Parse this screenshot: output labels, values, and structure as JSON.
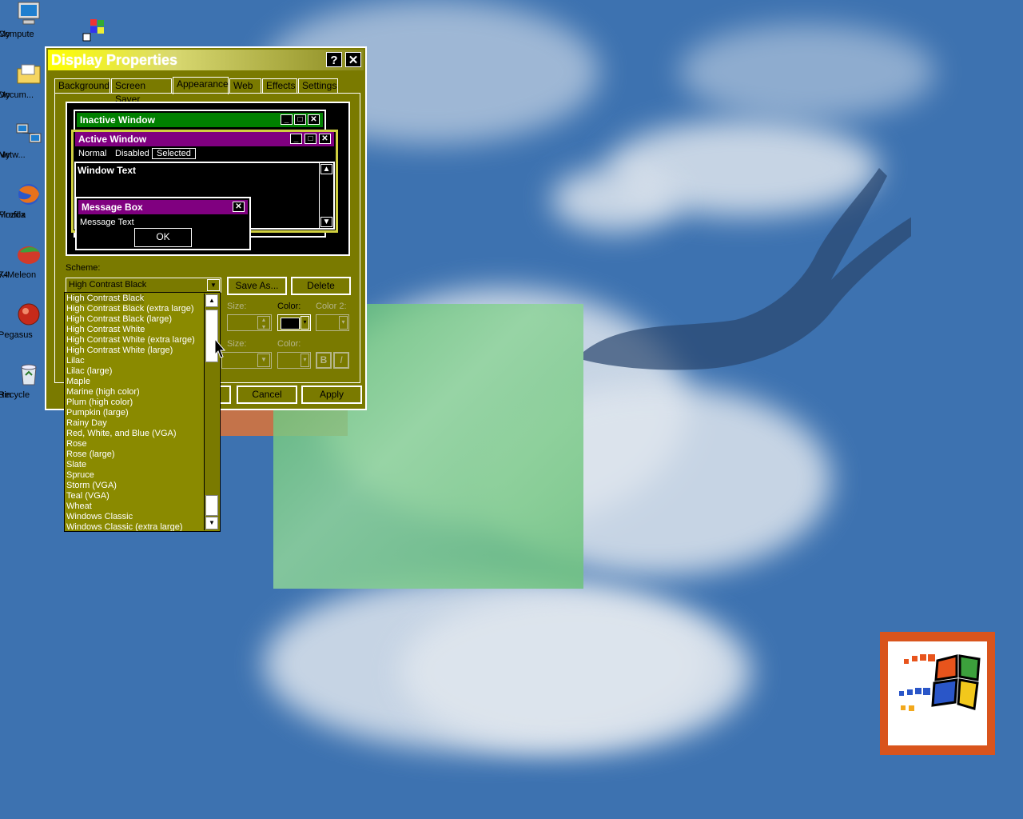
{
  "desktop": {
    "icons": [
      {
        "label1": "My",
        "label2": "Compute",
        "icon": "computer-icon"
      },
      {
        "label1": "My",
        "label2": "Docum...",
        "icon": "folder-icon"
      },
      {
        "label1": "My",
        "label2": "Netw...",
        "icon": "network-icon"
      },
      {
        "label1": "Mozilla",
        "label2": "Firefox",
        "icon": "firefox-icon"
      },
      {
        "label1": "K-Meleon",
        "label2": "74",
        "icon": "kmeleon-icon"
      },
      {
        "label1": "Pegasus",
        "label2": "",
        "icon": "pegasus-icon"
      },
      {
        "label1": "Recycle",
        "label2": "Bin",
        "icon": "recycle-bin-icon"
      }
    ]
  },
  "window": {
    "title": "Display Properties",
    "help_btn": "?",
    "close_btn": "✕",
    "tabs": [
      "Background",
      "Screen Saver",
      "Appearance",
      "Web",
      "Effects",
      "Settings"
    ],
    "active_tab": "Appearance",
    "preview": {
      "inactive_title": "Inactive Window",
      "active_title": "Active Window",
      "menu_normal": "Normal",
      "menu_disabled": "Disabled",
      "menu_selected": "Selected",
      "window_text": "Window Text",
      "msgbox_title": "Message Box",
      "msgbox_text": "Message Text",
      "ok": "OK"
    },
    "scheme_label": "Scheme:",
    "scheme_value": "High Contrast Black",
    "save_as": "Save As...",
    "delete": "Delete",
    "size_label": "Size:",
    "color_label": "Color:",
    "color2_label": "Color 2:",
    "size_label2": "Size:",
    "color_label2": "Color:",
    "bold": "B",
    "italic": "I",
    "cancel": "Cancel",
    "apply": "Apply"
  },
  "scheme_list": [
    "High Contrast Black",
    "High Contrast Black (extra large)",
    "High Contrast Black (large)",
    "High Contrast White",
    "High Contrast White (extra large)",
    "High Contrast White (large)",
    "Lilac",
    "Lilac (large)",
    "Maple",
    "Marine (high color)",
    "Plum (high color)",
    "Pumpkin (large)",
    "Rainy Day",
    "Red, White, and Blue (VGA)",
    "Rose",
    "Rose (large)",
    "Slate",
    "Spruce",
    "Storm (VGA)",
    "Teal (VGA)",
    "Wheat",
    "Windows Classic",
    "Windows Classic (extra large)"
  ],
  "colors": {
    "face": "#7a7a00",
    "title_active": "#800080",
    "title_inactive": "#008000",
    "desktop": "#3d72b0"
  }
}
